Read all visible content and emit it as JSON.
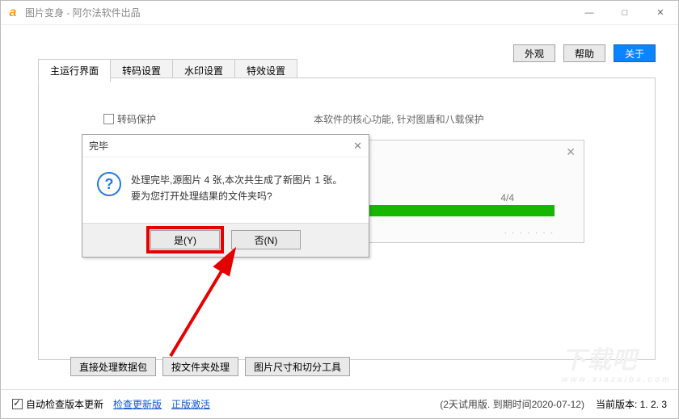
{
  "window": {
    "title": "图片变身 - 阿尔法软件出品",
    "icon_letter": "a"
  },
  "top_buttons": {
    "appearance": "外观",
    "help": "帮助",
    "about": "关于"
  },
  "tabs": {
    "t0": "主运行界面",
    "t1": "转码设置",
    "t2": "水印设置",
    "t3": "特效设置"
  },
  "panel": {
    "transcode_protect": "转码保护",
    "hint": "本软件的核心功能, 针对图盾和八载保护"
  },
  "utils": {
    "b0": "直接处理数据包",
    "b1": "按文件夹处理",
    "b2": "图片尺寸和切分工具"
  },
  "progress": {
    "label": "4/4"
  },
  "dialog": {
    "title": "完毕",
    "line1": "处理完毕,源图片 4 张,本次共生成了新图片 1 张。",
    "line2": "要为您打开处理结果的文件夹吗?",
    "yes": "是(Y)",
    "no": "否(N)"
  },
  "status": {
    "auto_check": "自动检查版本更新",
    "check_link": "检查更新版",
    "activate_link": "正版激活",
    "trial": "(2天试用版. 到期时间2020-07-12)",
    "version": "当前版本: 1. 2. 3"
  },
  "watermark": {
    "big": "下载吧",
    "small": "www.xiazaiba.com"
  }
}
